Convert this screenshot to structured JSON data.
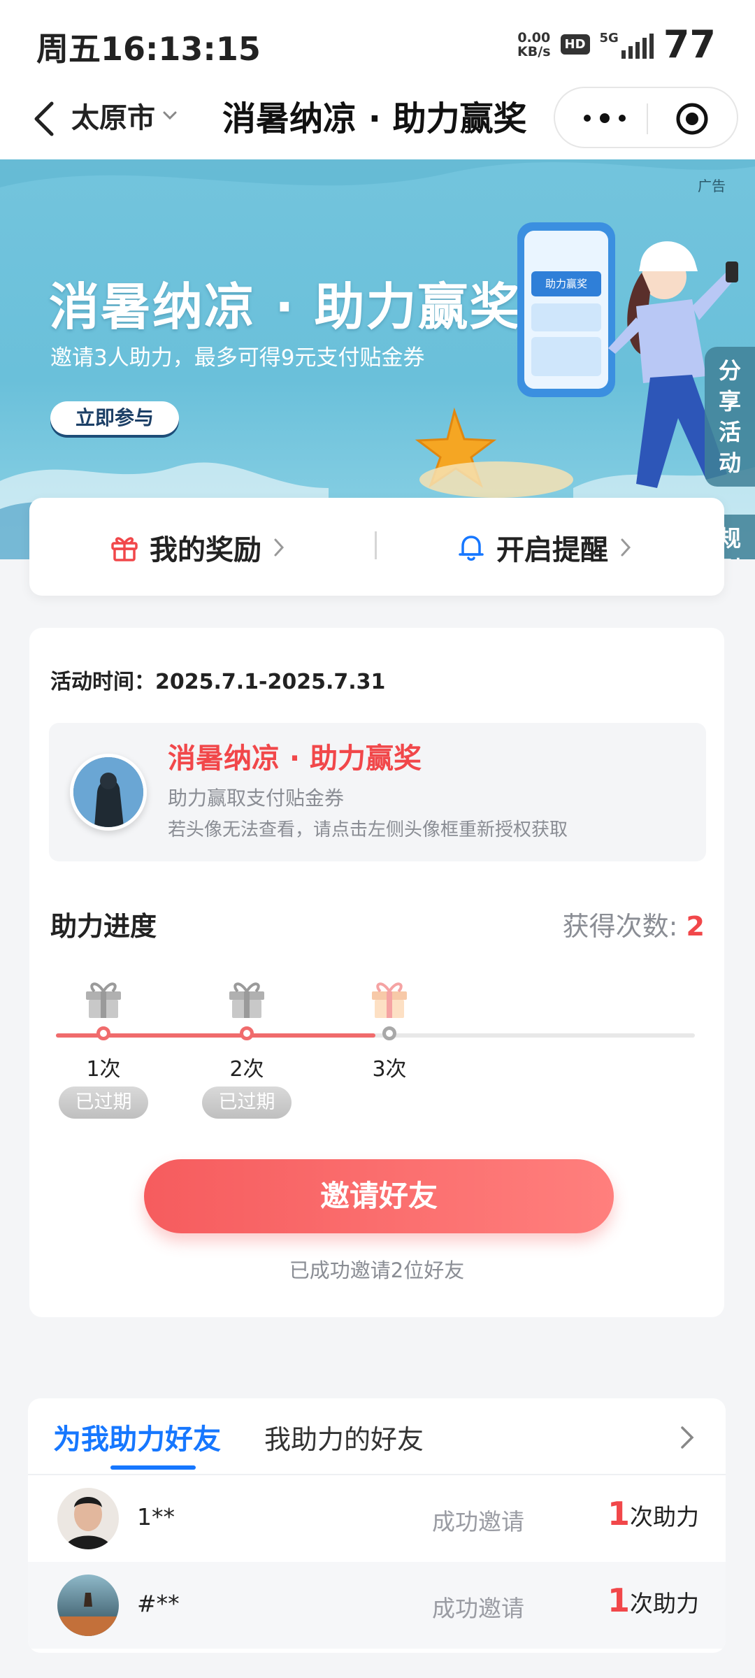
{
  "status_bar": {
    "time": "周五16:13:15",
    "net_speed_value": "0.00",
    "net_speed_unit": "KB/s",
    "hd": "HD",
    "network": "5G",
    "battery": "77"
  },
  "nav": {
    "city": "太原市",
    "title": "消暑纳凉 · 助力赢奖",
    "icons": [
      "back-arrow-icon",
      "chevron-down-icon",
      "more-icon",
      "target-icon"
    ]
  },
  "banner": {
    "ad_label": "广告",
    "headline": "消暑纳凉 · 助力赢奖",
    "subtitle": "邀请3人助力，最多可得9元支付贴金券",
    "cta": "立即参与",
    "phone_text": "助力赢奖",
    "side_share": "分享活动",
    "side_rules": "规则"
  },
  "reward_bar": {
    "my_reward": "我的奖励",
    "reminder": "开启提醒",
    "icons": [
      "gift-icon",
      "bell-icon",
      "chevron-right-icon"
    ]
  },
  "activity": {
    "period": "活动时间：2025.7.1-2025.7.31",
    "info_title": "消暑纳凉 · 助力赢奖",
    "info_desc": "助力赢取支付贴金券",
    "info_hint": "若头像无法查看，请点击左侧头像框重新授权获取",
    "progress_title": "助力进度",
    "count_label": "获得次数:",
    "count_value": "2",
    "progress_fraction": 0.5,
    "steps": [
      {
        "label": "1次",
        "status": "已过期",
        "reached": true
      },
      {
        "label": "2次",
        "status": "已过期",
        "reached": true
      },
      {
        "label": "3次",
        "status": "",
        "reached": false
      }
    ],
    "invite_button": "邀请好友",
    "invited_text": "已成功邀请2位好友"
  },
  "friends": {
    "tab_active": "为我助力好友",
    "tab_other": "我助力的好友",
    "rows": [
      {
        "name": "1**",
        "status": "成功邀请",
        "count": "1",
        "unit": "次助力"
      },
      {
        "name": "#**",
        "status": "成功邀请",
        "count": "1",
        "unit": "次助力"
      }
    ]
  },
  "colors": {
    "accent_red": "#f1474a",
    "accent_blue": "#1677ff",
    "banner_bg": "#6ac0da"
  }
}
